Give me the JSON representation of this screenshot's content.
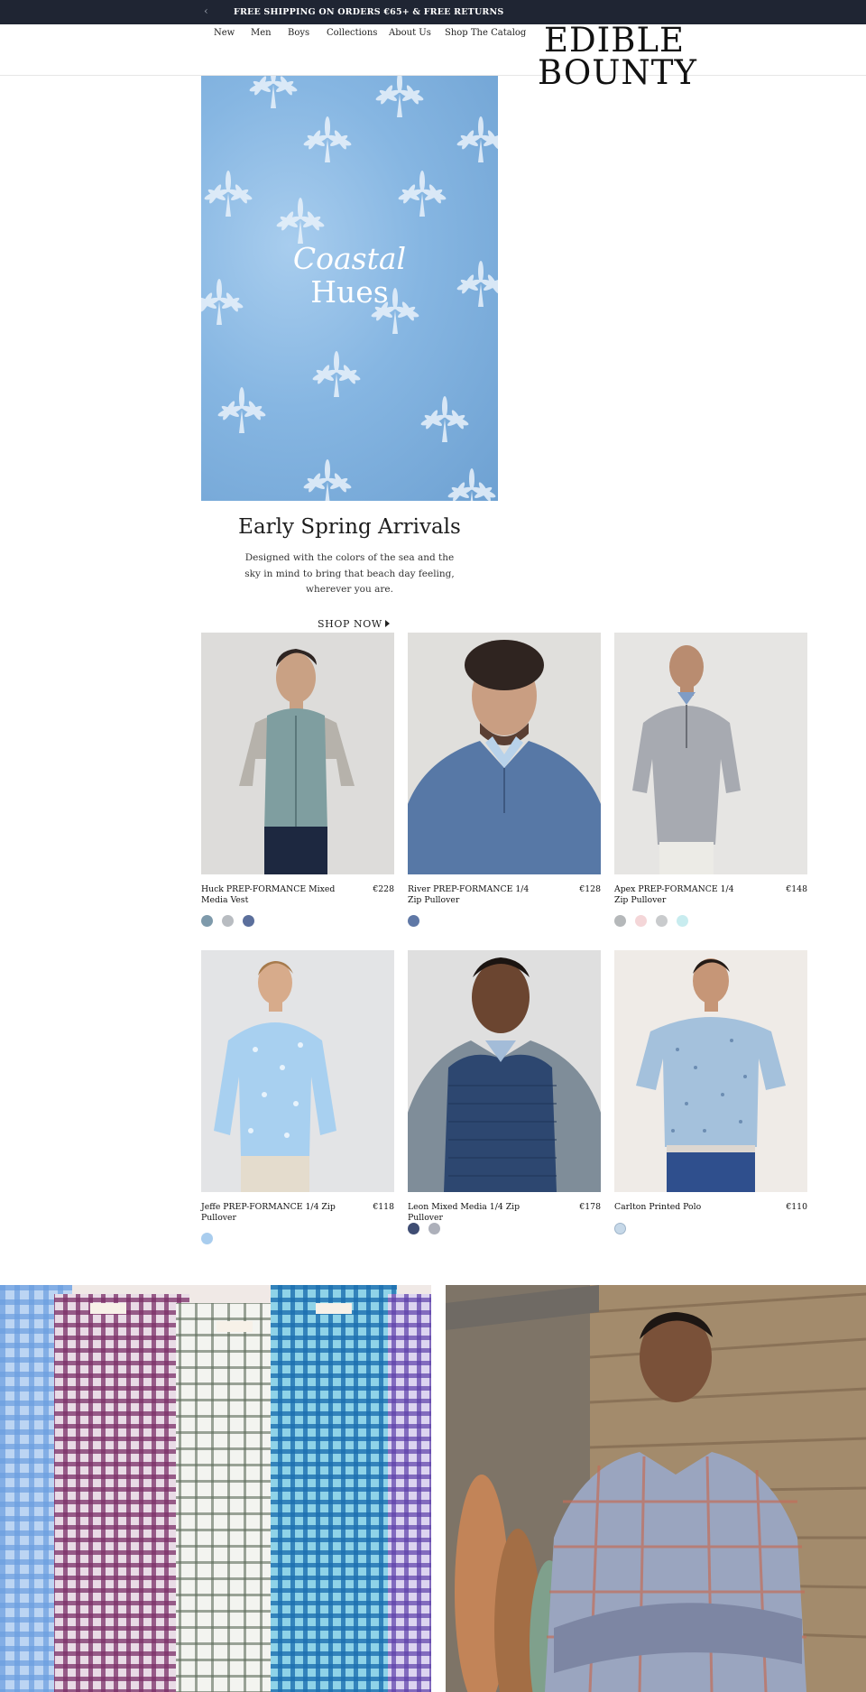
{
  "promo": {
    "arrow_icon": "chevron-left-icon",
    "arrow": "‹",
    "text": "FREE SHIPPING ON ORDERS €65+ & FREE RETURNS"
  },
  "nav": {
    "items": [
      "New",
      "Men",
      "Boys",
      "Collections",
      "About Us",
      "Shop The Catalog"
    ]
  },
  "logo": {
    "line1": "EDIBLE",
    "line2": "BOUNTY"
  },
  "hero": {
    "word1": "Coastal",
    "word2": "Hues"
  },
  "section": {
    "title": "Early Spring Arrivals",
    "description": "Designed with the colors of the sea and the sky in mind to bring that beach day feeling, wherever you are.",
    "cta": "SHOP NOW"
  },
  "products": [
    {
      "name": "Huck PREP-FORMANCE Mixed Media Vest",
      "price": "€228",
      "swatches": [
        "#7e9aab",
        "#b8bcc1",
        "#5b6f9c"
      ]
    },
    {
      "name": "River PREP-FORMANCE 1/4 Zip Pullover",
      "price": "€128",
      "swatches": [
        "#5f78a6"
      ]
    },
    {
      "name": "Apex PREP-FORMANCE 1/4 Zip Pullover",
      "price": "€148",
      "swatches": [
        "#b5b8ba",
        "#f4d6d8",
        "#c9cbcd",
        "#c8ecef"
      ]
    },
    {
      "name": "Jeffe PREP-FORMANCE 1/4 Zip Pullover",
      "price": "€118",
      "swatches": [
        "#a9cdee"
      ]
    },
    {
      "name": "Leon Mixed Media 1/4 Zip Pullover",
      "price": "€178",
      "swatches": [
        "#3f4d73",
        "#adb0ba"
      ]
    },
    {
      "name": "Carlton Printed Polo",
      "price": "€110",
      "swatches": [
        "#c6d8e8"
      ]
    }
  ],
  "colors": {
    "promo_bg": "#1f2533",
    "accent": "#1c1c1c"
  }
}
